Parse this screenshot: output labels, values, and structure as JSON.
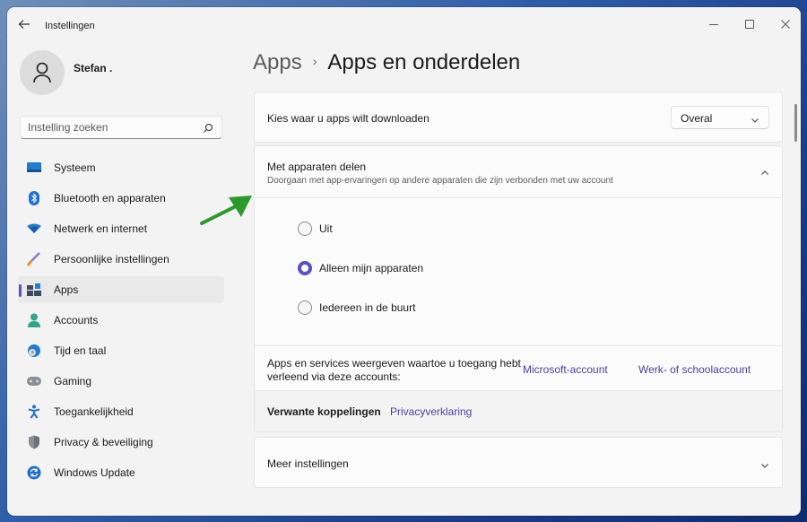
{
  "window": {
    "title": "Instellingen",
    "controls": {
      "minimize": "minimize",
      "maximize": "maximize",
      "close": "close"
    }
  },
  "user": {
    "name": "Stefan ."
  },
  "search": {
    "placeholder": "Instelling zoeken"
  },
  "sidebar": {
    "items": [
      {
        "label": "Systeem",
        "icon": "monitor-icon"
      },
      {
        "label": "Bluetooth en apparaten",
        "icon": "bluetooth-icon"
      },
      {
        "label": "Netwerk en internet",
        "icon": "wifi-icon"
      },
      {
        "label": "Persoonlijke instellingen",
        "icon": "brush-icon"
      },
      {
        "label": "Apps",
        "icon": "apps-icon",
        "active": true
      },
      {
        "label": "Accounts",
        "icon": "person-icon"
      },
      {
        "label": "Tijd en taal",
        "icon": "globe-clock-icon"
      },
      {
        "label": "Gaming",
        "icon": "gamepad-icon"
      },
      {
        "label": "Toegankelijkheid",
        "icon": "accessibility-icon"
      },
      {
        "label": "Privacy & beveiliging",
        "icon": "shield-icon"
      },
      {
        "label": "Windows Update",
        "icon": "update-icon"
      }
    ]
  },
  "breadcrumb": {
    "parent": "Apps",
    "separator": "›",
    "current": "Apps en onderdelen"
  },
  "download_setting": {
    "label": "Kies waar u apps wilt downloaden",
    "value": "Overal"
  },
  "share": {
    "title": "Met apparaten delen",
    "subtitle": "Doorgaan met app-ervaringen op andere apparaten die zijn verbonden met uw account",
    "expanded": true,
    "options": [
      {
        "label": "Uit",
        "checked": false
      },
      {
        "label": "Alleen mijn apparaten",
        "checked": true
      },
      {
        "label": "Iedereen in de buurt",
        "checked": false
      }
    ],
    "accounts_text": "Apps en services weergeven waartoe u toegang hebt verleend via deze accounts:",
    "microsoft_link": "Microsoft-account",
    "work_link": "Werk- of schoolaccount",
    "related_label": "Verwante koppelingen",
    "privacy_link": "Privacyverklaring"
  },
  "more_settings": {
    "label": "Meer instellingen"
  },
  "colors": {
    "accent": "#5a4fc4",
    "link": "#4a3f9e",
    "annotation_arrow": "#2a9a2a"
  }
}
